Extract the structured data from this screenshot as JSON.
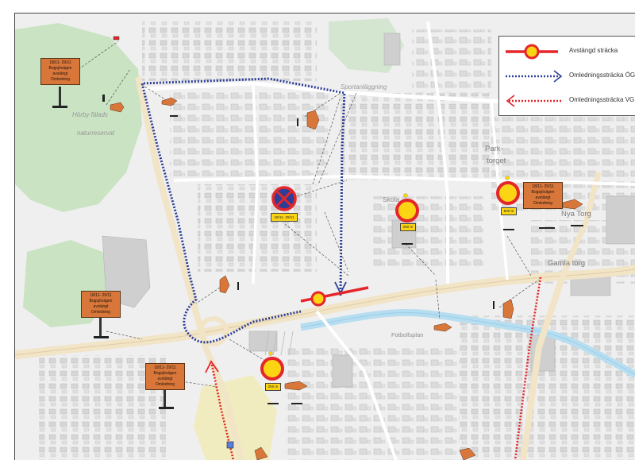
{
  "legend": {
    "items": [
      {
        "label": "Avstängd sträcka"
      },
      {
        "label": "Omledningssträcka ÖG"
      },
      {
        "label": "Omledningssträcka VG"
      }
    ]
  },
  "places": {
    "horby_falads": "Hörby fälads",
    "naturreservat": "naturreservat",
    "sportanlaggning": "Sportanläggning",
    "park": "Park-",
    "torget": "torget",
    "skola": "Skola",
    "nya_torg": "Nya Torg",
    "gamla_torg": "Gamla torg",
    "fotbollsplan": "Fotbollsplan"
  },
  "signs": [
    {
      "date": "18/11- 29/11",
      "road": "Bogsjövägen",
      "status": "avstängt",
      "detour": "Omledning"
    },
    {
      "date": "18/11- 29/11",
      "road": "Bogsjövägen",
      "status": "avstängt",
      "detour": "Omledning"
    },
    {
      "date": "18/11- 29/11",
      "road": "Bogsjövägen",
      "status": "avstängt",
      "detour": "Omledning"
    },
    {
      "date": "18/11- 29/11",
      "road": "Bogsjövägen",
      "status": "avstängt",
      "detour": "Omledning"
    }
  ],
  "no_parking_date": "18/11- 29/11",
  "distances": {
    "skola": "250 m",
    "bottom": "250 m",
    "park": "500 m"
  },
  "colors": {
    "closed_road": "#e4262b",
    "detour_og": "#2c3e97",
    "detour_vg": "#e4262b",
    "sign_orange": "#d9773b",
    "warning_yellow": "#fbd514",
    "water": "#b7def0",
    "forest": "#c9e3c3",
    "field": "#f1ecc0"
  }
}
